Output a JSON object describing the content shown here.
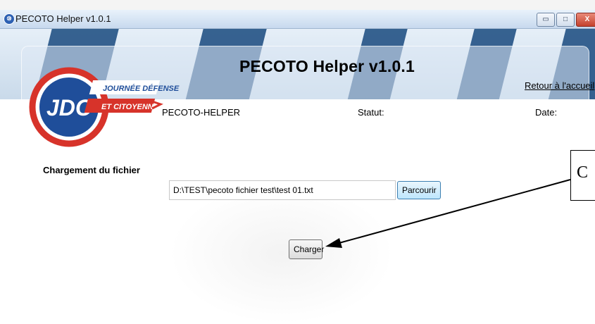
{
  "window": {
    "title": "PECOTO Helper v1.0.1",
    "icon": "jdc-app-icon",
    "controls": {
      "minimize": "▭",
      "maximize": "□",
      "close": "X"
    }
  },
  "banner": {
    "title": "PECOTO Helper v1.0.1",
    "home_link": "Retour à l'accueil",
    "stripe_color": "#2c5a8a"
  },
  "logo": {
    "letters": "JDC",
    "line1": "JOURNÉE DÉFENSE",
    "line2": "ET CITOYENNETÉ",
    "colors": {
      "red": "#d7332a",
      "blue": "#1f4e9a",
      "orange": "#f2a23a"
    }
  },
  "header_row": {
    "app": "PECOTO-HELPER",
    "status": "Statut:",
    "date": "Date:"
  },
  "upload": {
    "section_label": "Chargement du fichier",
    "file_path": "D:\\TEST\\pecoto fichier test\\test 01.txt",
    "browse_label": "Parcourir",
    "load_label": "Charger"
  },
  "annotation": {
    "callout_text": "C"
  }
}
